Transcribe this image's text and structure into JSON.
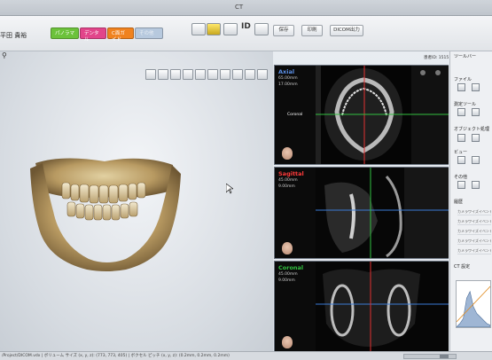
{
  "window": {
    "title": "CT"
  },
  "patient": {
    "name": "平田 貴裕"
  },
  "top_info": "患者ID: 1515 | 名前: 平田 貴裕 | 生",
  "modes": {
    "panorama": "パノラマ",
    "dental": "デンタル",
    "cephalo": "C面ガイド",
    "other": "その他"
  },
  "toolbar": {
    "id_label": "ID",
    "save": "保存",
    "print": "印刷",
    "dicom": "DICOM出力"
  },
  "panels": {
    "axial": {
      "title": "Axial",
      "line1": "65.00mm",
      "line2": "17.00mm",
      "tag": "Coronal",
      "color": "#3a7bd5"
    },
    "sagittal": {
      "title": "Sagittal",
      "line1": "45.00mm",
      "line2": "9.00mm",
      "color": "#e03030"
    },
    "coronal": {
      "title": "Coronal",
      "line1": "45.00mm",
      "line2": "9.00mm",
      "color": "#32c040"
    }
  },
  "sidepanel": {
    "toolbar_title": "ツールバー",
    "file": "ファイル",
    "measure": "測定ツール",
    "object": "オブジェクト処理",
    "view": "ビュー",
    "other": "その他",
    "history_title": "履歴",
    "history_items": [
      "カメラワイズイベント",
      "カメラワイズイベント",
      "カメラワイズイベント",
      "カメラワイズイベント",
      "カメラワイズイベント"
    ],
    "ct_setting": "CT 設定"
  },
  "status": {
    "text": "/Project/DICOM.vdx | ボリューム サイズ (x, y, z): (773, 773, 405) | ボクセル ピッチ (x, y, z): (0.2mm, 0.2mm, 0.2mm)"
  }
}
